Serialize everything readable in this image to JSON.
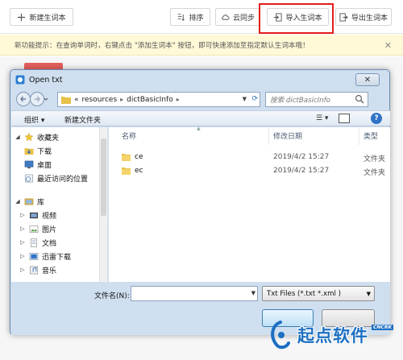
{
  "toolbar": {
    "new_label": "新建生词本",
    "sort_label": "排序",
    "sync_label": "云同步",
    "import_label": "导入生词本",
    "export_label": "导出生词本"
  },
  "tip": {
    "text": "新功能提示：在查询单词时，右键点击 \"添加生词本\" 按钮，即可快速添加至指定默认生词本哦！",
    "close": "✕"
  },
  "dialog": {
    "title": "Open txt",
    "close": "✕",
    "address": {
      "prefix": "«",
      "segments": [
        "resources",
        "dictBasicInfo"
      ],
      "separator": "▸"
    },
    "search_placeholder": "搜索 dictBasicInfo",
    "commands": {
      "organize": "组织 ▾",
      "new_folder": "新建文件夹"
    },
    "nav": {
      "items": [
        {
          "label": "收藏夹",
          "icon": "star-icon",
          "expanded": true,
          "level": 0
        },
        {
          "label": "下载",
          "icon": "download-folder-icon",
          "level": 1
        },
        {
          "label": "桌面",
          "icon": "desktop-icon",
          "level": 1
        },
        {
          "label": "最近访问的位置",
          "icon": "recent-places-icon",
          "level": 1
        },
        {
          "label": "库",
          "icon": "library-icon",
          "expanded": true,
          "level": 0
        },
        {
          "label": "视频",
          "icon": "video-library-icon",
          "level": 1
        },
        {
          "label": "图片",
          "icon": "pictures-library-icon",
          "level": 1
        },
        {
          "label": "文档",
          "icon": "documents-library-icon",
          "level": 1
        },
        {
          "label": "迅雷下载",
          "icon": "thunder-download-icon",
          "level": 1
        },
        {
          "label": "音乐",
          "icon": "music-library-icon",
          "level": 1
        }
      ]
    },
    "columns": {
      "name": "名称",
      "date": "修改日期",
      "type": "类型"
    },
    "files": [
      {
        "name": "ce",
        "date": "2019/4/2 15:27",
        "type": "文件夹"
      },
      {
        "name": "ec",
        "date": "2019/4/2 15:27",
        "type": "文件夹"
      }
    ],
    "filename_label": "文件名(N):",
    "filename_value": "",
    "filetype_value": "Txt Files (*.txt *.xml )"
  },
  "watermark": {
    "text": "起点软件",
    "badge": "CNCRK"
  },
  "colors": {
    "highlight": "#e21d1d",
    "accent": "#1c6fc2",
    "tip_bg": "#fff9d7"
  }
}
